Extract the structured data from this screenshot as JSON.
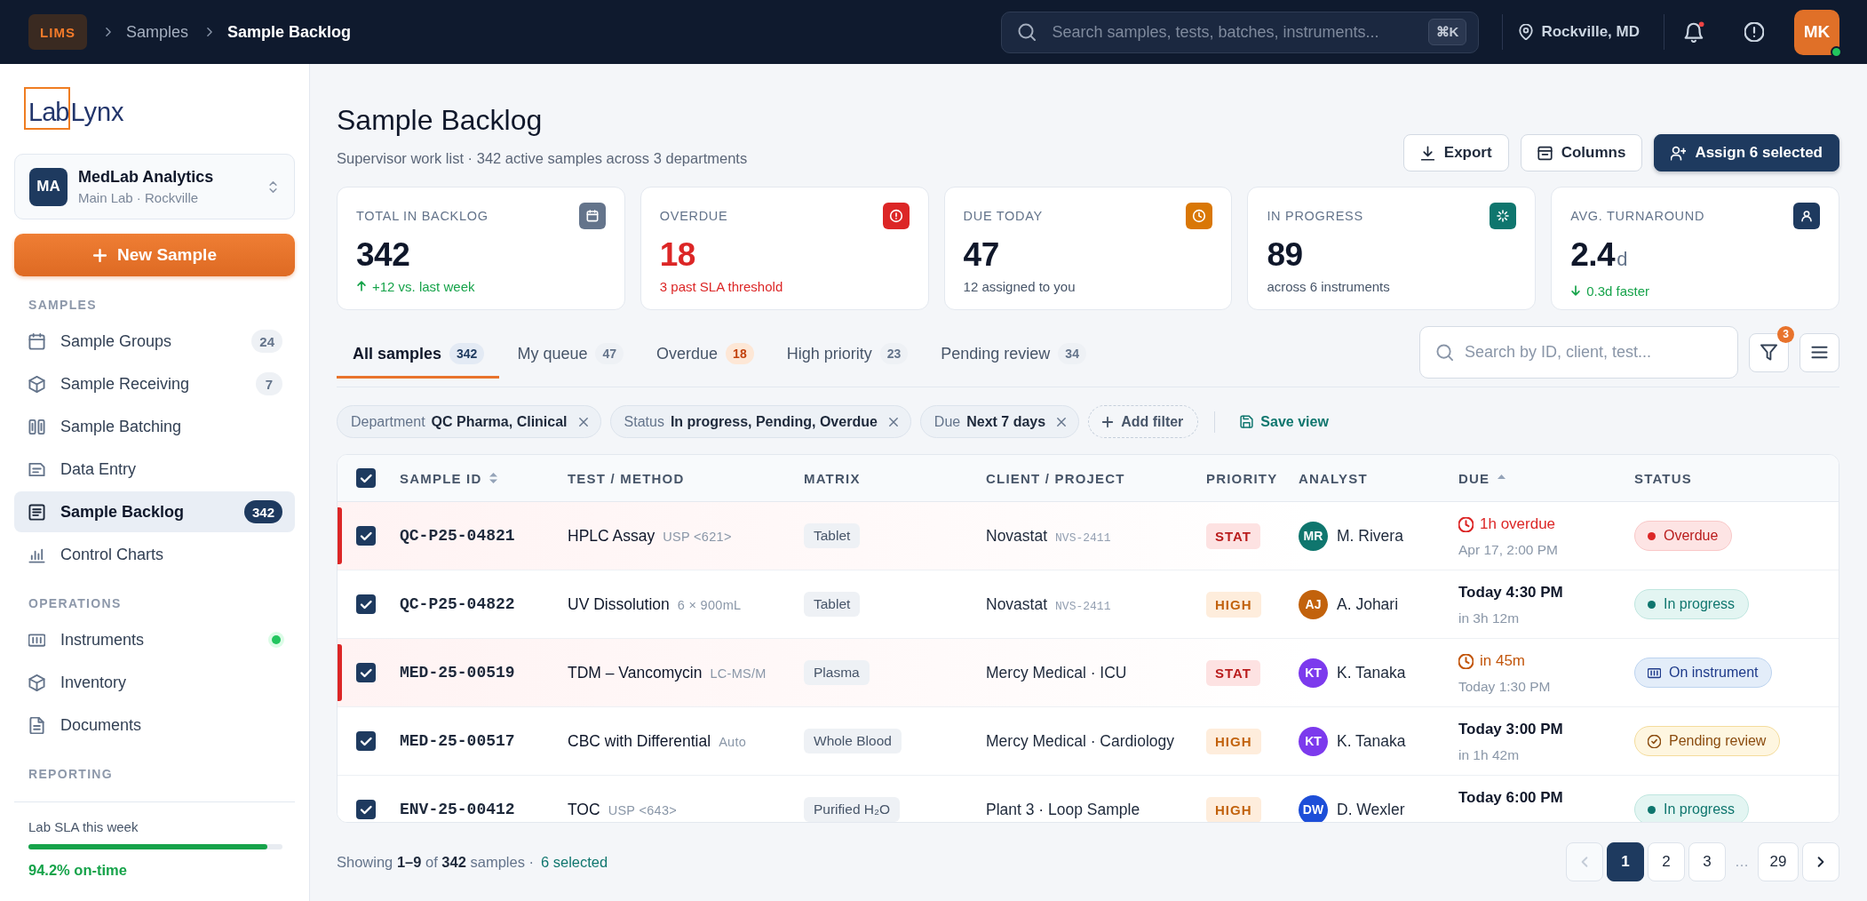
{
  "topbar": {
    "app_badge": "LIMS",
    "breadcrumb": [
      {
        "label": "Samples",
        "current": false
      },
      {
        "label": "Sample Backlog",
        "current": true
      }
    ],
    "search": {
      "placeholder": "Search samples, tests, batches, instruments...",
      "shortcut": "⌘K"
    },
    "location": "Rockville, MD",
    "notifications": {
      "unread": true
    },
    "user": {
      "initials": "MK",
      "online": true
    }
  },
  "sidebar": {
    "logo": {
      "boxed": "Lab",
      "rest": "Lynx"
    },
    "org": {
      "initials": "MA",
      "name": "MedLab Analytics",
      "location": "Main Lab · Rockville"
    },
    "new_button": "New Sample",
    "sections": [
      {
        "title": "SAMPLES",
        "items": [
          {
            "label": "Sample Groups",
            "count": "24",
            "selected": false
          },
          {
            "label": "Sample Receiving",
            "count": "7",
            "selected": false
          },
          {
            "label": "Sample Batching",
            "selected": false
          },
          {
            "label": "Data Entry",
            "selected": false
          },
          {
            "label": "Sample Backlog",
            "count": "342",
            "selected": true
          },
          {
            "label": "Control Charts",
            "selected": false
          }
        ]
      },
      {
        "title": "OPERATIONS",
        "items": [
          {
            "label": "Instruments",
            "selected": false,
            "online": true
          },
          {
            "label": "Inventory",
            "selected": false
          },
          {
            "label": "Documents",
            "selected": false
          }
        ]
      },
      {
        "title": "REPORTING"
      }
    ],
    "sla": {
      "label": "Lab SLA this week",
      "level": 0.942,
      "reading": "94.2% on-time"
    }
  },
  "header": {
    "title": "Sample Backlog",
    "subtitle": "Supervisor work list · 342 active samples across 3 departments",
    "actions": [
      {
        "label": "Export",
        "kind": "secondary"
      },
      {
        "label": "Columns",
        "kind": "secondary"
      },
      {
        "label": "Assign 6 selected",
        "kind": "primary"
      }
    ]
  },
  "kpis": [
    {
      "label": "TOTAL IN BACKLOG",
      "value": "342",
      "note": "+12 vs. last week",
      "kind": "up",
      "color": "#64748b"
    },
    {
      "label": "OVERDUE",
      "value": "18",
      "note": "3 past SLA threshold",
      "kind": "alert",
      "color": "#dc2626"
    },
    {
      "label": "DUE TODAY",
      "value": "47",
      "note": "12 assigned to you",
      "kind": "plain",
      "color": "#d97706"
    },
    {
      "label": "IN PROGRESS",
      "value": "89",
      "note": "across 6 instruments",
      "kind": "plain",
      "color": "#0f766e"
    },
    {
      "label": "AVG. TURNAROUND",
      "value": "2.4",
      "unit": "d",
      "note": "0.3d faster",
      "kind": "down",
      "color": "#1e3a5f"
    }
  ],
  "tabs": [
    {
      "label": "All samples",
      "count": "342",
      "selected": true,
      "alert": false
    },
    {
      "label": "My queue",
      "count": "47",
      "selected": false,
      "alert": false
    },
    {
      "label": "Overdue",
      "count": "18",
      "selected": false,
      "alert": true
    },
    {
      "label": "High priority",
      "count": "23",
      "selected": false,
      "alert": false
    },
    {
      "label": "Pending review",
      "count": "34",
      "selected": false,
      "alert": false
    }
  ],
  "toolbar": {
    "search": {
      "placeholder": "Search by ID, client, test..."
    },
    "filter_count": "3"
  },
  "filters": {
    "chips": [
      {
        "field": "Department",
        "value": "QC Pharma, Clinical"
      },
      {
        "field": "Status",
        "value": "In progress, Pending, Overdue"
      },
      {
        "field": "Due",
        "value": "Next 7 days"
      }
    ],
    "add_label": "Add filter",
    "save_label": "Save view"
  },
  "table": {
    "select_all": {
      "checked": true
    },
    "columns": [
      {
        "label": "SAMPLE ID",
        "kind": "sortable"
      },
      {
        "label": "TEST / METHOD",
        "kind": "plain"
      },
      {
        "label": "MATRIX",
        "kind": "plain"
      },
      {
        "label": "CLIENT / PROJECT",
        "kind": "plain"
      },
      {
        "label": "PRIORITY",
        "kind": "plain"
      },
      {
        "label": "ANALYST",
        "kind": "plain"
      },
      {
        "label": "DUE",
        "kind": "sorted"
      },
      {
        "label": "STATUS",
        "kind": "plain"
      }
    ],
    "rows": [
      {
        "checked": true,
        "flagged": true,
        "sample_id": "QC-P25-04821",
        "test": "HPLC Assay",
        "method": "USP <621>",
        "matrix": "Tablet",
        "client": "Novastat",
        "project": "NVS-2411",
        "priority": {
          "label": "STAT",
          "kind": "stat"
        },
        "analyst": {
          "initials": "MR",
          "name": "M. Rivera",
          "color": "#0f766e"
        },
        "due": {
          "kind": "overdue",
          "main": "1h overdue",
          "sub": "Apr 17, 2:00 PM"
        },
        "status": {
          "label": "Overdue",
          "kind": "overdue"
        }
      },
      {
        "checked": true,
        "flagged": false,
        "sample_id": "QC-P25-04822",
        "test": "UV Dissolution",
        "method": "6 × 900mL",
        "matrix": "Tablet",
        "client": "Novastat",
        "project": "NVS-2411",
        "priority": {
          "label": "HIGH",
          "kind": "high"
        },
        "analyst": {
          "initials": "AJ",
          "name": "A. Johari",
          "color": "#c2620c"
        },
        "due": {
          "kind": "normal",
          "main": "Today 4:30 PM",
          "sub": "in 3h 12m"
        },
        "status": {
          "label": "In progress",
          "kind": "progress"
        }
      },
      {
        "checked": true,
        "flagged": true,
        "sample_id": "MED-25-00519",
        "test": "TDM – Vancomycin",
        "method": "LC-MS/M",
        "matrix": "Plasma",
        "client": "Mercy Medical · ICU",
        "priority": {
          "label": "STAT",
          "kind": "stat"
        },
        "analyst": {
          "initials": "KT",
          "name": "K. Tanaka",
          "color": "#7c3aed"
        },
        "due": {
          "kind": "soon",
          "main": "in 45m",
          "sub": "Today 1:30 PM"
        },
        "status": {
          "label": "On instrument",
          "kind": "instrument"
        }
      },
      {
        "checked": true,
        "flagged": false,
        "sample_id": "MED-25-00517",
        "test": "CBC with Differential",
        "method": "Auto",
        "matrix": "Whole Blood",
        "client": "Mercy Medical · Cardiology",
        "priority": {
          "label": "HIGH",
          "kind": "high"
        },
        "analyst": {
          "initials": "KT",
          "name": "K. Tanaka",
          "color": "#7c3aed"
        },
        "due": {
          "kind": "normal",
          "main": "Today 3:00 PM",
          "sub": "in 1h 42m"
        },
        "status": {
          "label": "Pending review",
          "kind": "review"
        }
      },
      {
        "checked": true,
        "flagged": false,
        "sample_id": "ENV-25-00412",
        "test": "TOC",
        "method": "USP <643>",
        "matrix": "Purified H₂O",
        "client": "Plant 3 · Loop Sample",
        "priority": {
          "label": "HIGH",
          "kind": "high"
        },
        "analyst": {
          "initials": "DW",
          "name": "D. Wexler",
          "color": "#1d4ed8"
        },
        "due": {
          "kind": "normal",
          "main": "Today 6:00 PM"
        },
        "status": {
          "label": "In progress",
          "kind": "progress"
        }
      }
    ]
  },
  "footer": {
    "summary": "Showing **1–9** of **342** samples ·",
    "selected_link": "6 selected",
    "pagination": {
      "prev": {
        "disabled": true
      },
      "pages": [
        {
          "label": "1",
          "selected": true
        },
        {
          "label": "2",
          "selected": false
        },
        {
          "label": "3",
          "selected": false
        }
      ],
      "ellipsis": "…",
      "last": {
        "label": "29",
        "selected": false
      },
      "next": {
        "disabled": false
      }
    }
  }
}
